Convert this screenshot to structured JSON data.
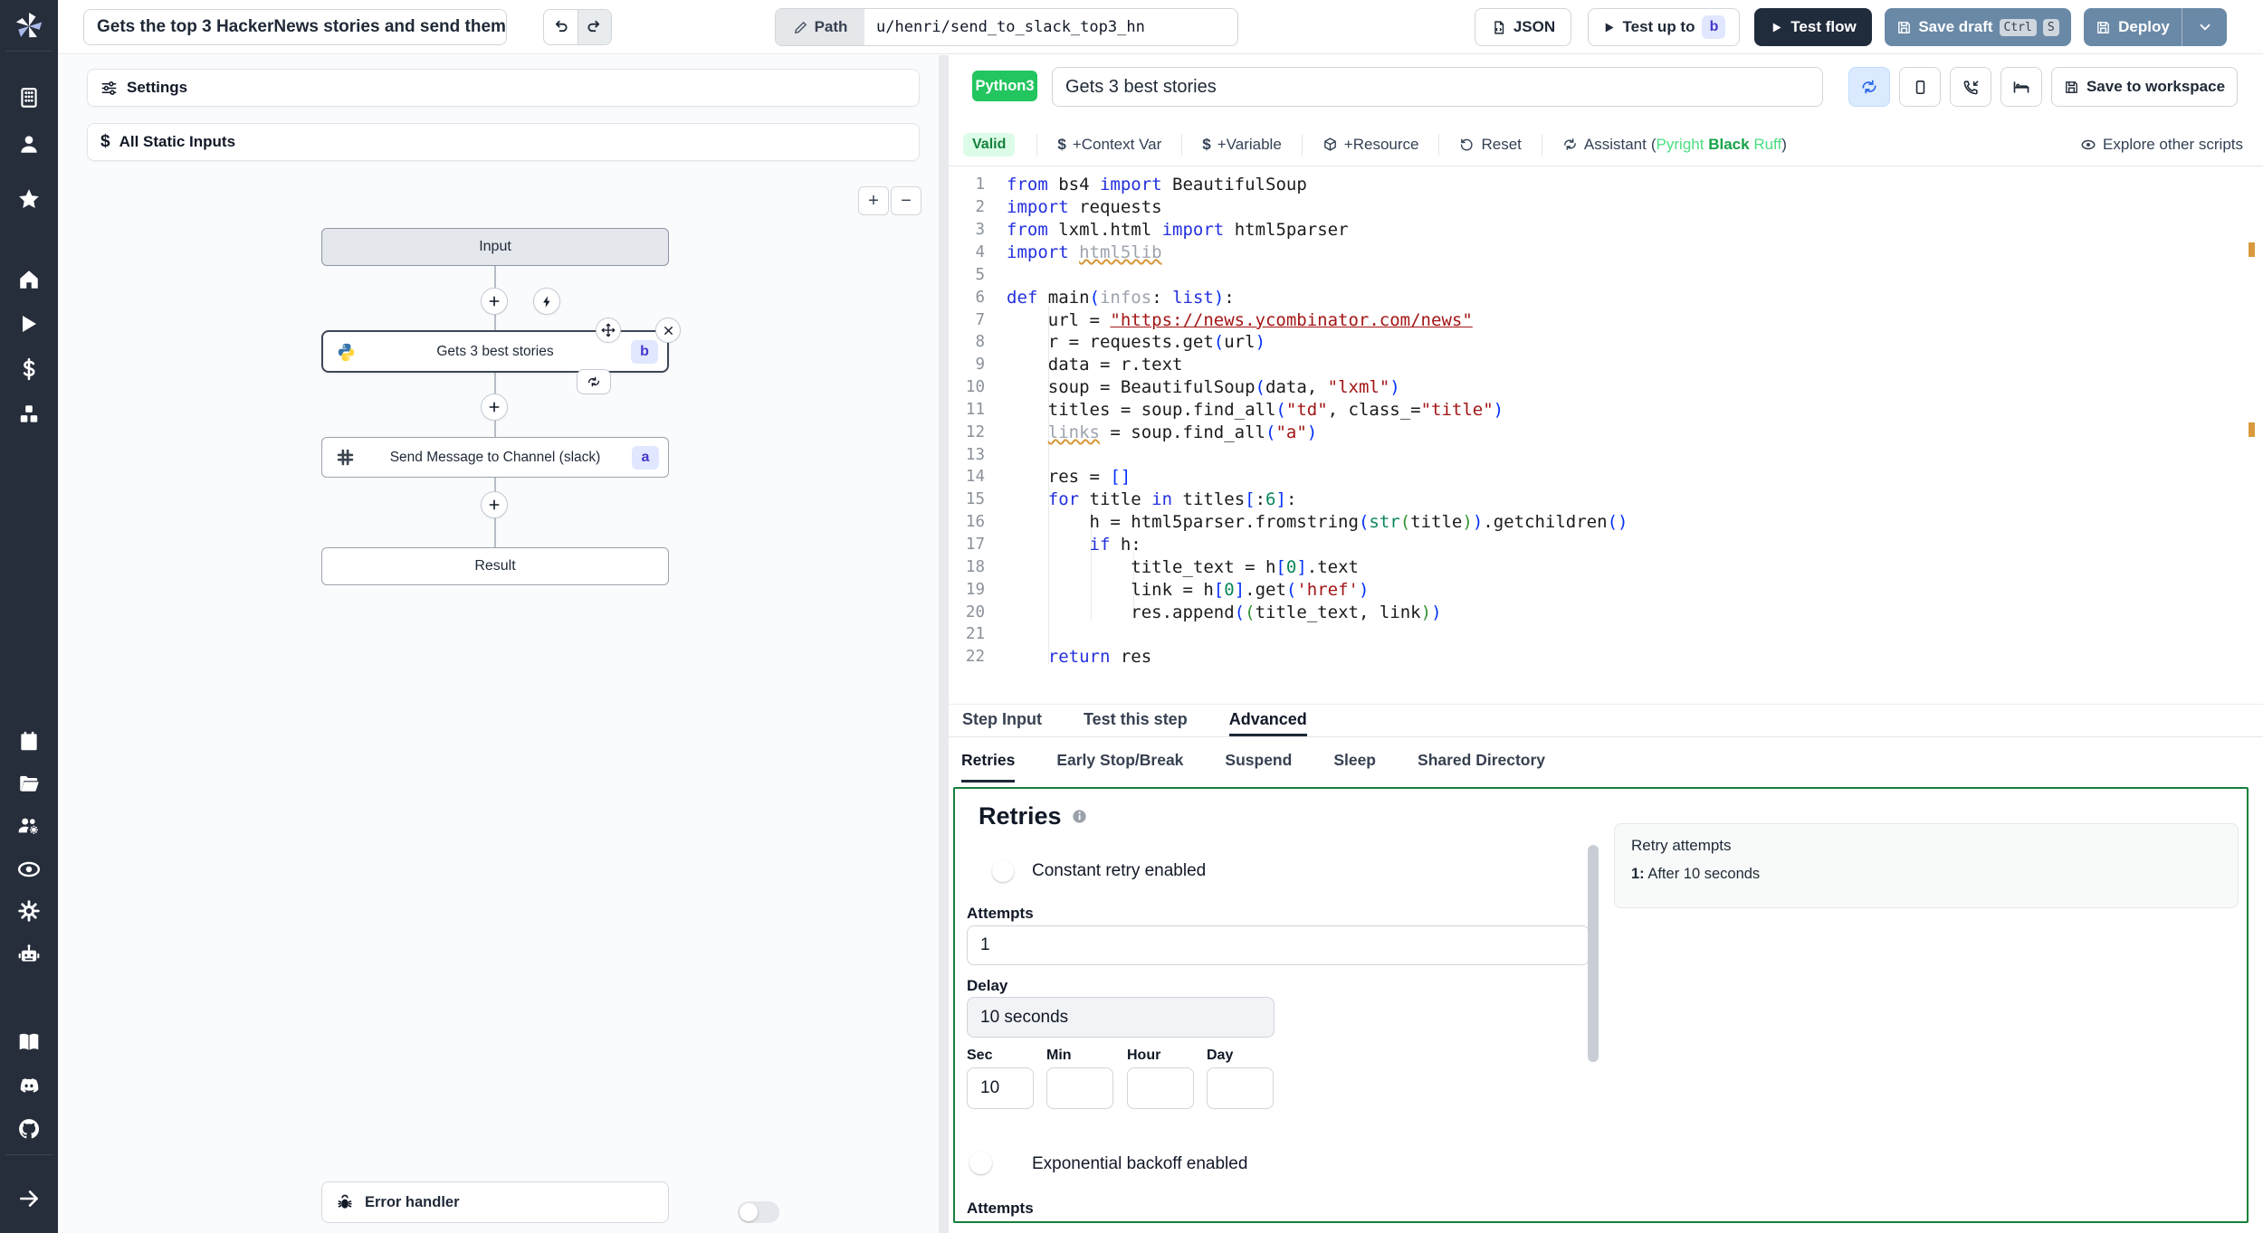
{
  "topbar": {
    "flow_title": "Gets the top 3 HackerNews stories and send them",
    "path_label": "Path",
    "path_value": "u/henri/send_to_slack_top3_hn",
    "json_label": "JSON",
    "test_up_to_label": "Test up to",
    "test_up_to_badge": "b",
    "test_flow_label": "Test flow",
    "save_draft_label": "Save draft",
    "kbd": [
      "Ctrl",
      "S"
    ],
    "deploy_label": "Deploy"
  },
  "sidebar": {
    "icons_top": [
      "building-icon",
      "user-icon",
      "star-icon"
    ],
    "icons_mid": [
      "home-icon",
      "play-icon",
      "dollar-icon",
      "boxes-icon"
    ],
    "icons_lower": [
      "calendar-icon",
      "folder-open-icon",
      "users-gear-icon",
      "eye-icon",
      "gear-icon",
      "robot-icon"
    ],
    "icons_docs": [
      "book-icon",
      "discord-icon",
      "github-icon"
    ],
    "icon_bottom": "arrow-right-icon"
  },
  "left_panel": {
    "settings_label": "Settings",
    "static_inputs_label": "All Static Inputs",
    "nodes": {
      "input": "Input",
      "step_b_label": "Gets 3 best stories",
      "step_b_badge": "b",
      "step_a_label": "Send Message to Channel (slack)",
      "step_a_badge": "a",
      "result": "Result",
      "error_handler": "Error handler"
    }
  },
  "editor": {
    "lang_badge": "Python3",
    "step_title": "Gets 3 best stories",
    "save_workspace_label": "Save to workspace",
    "toolbar": {
      "valid": "Valid",
      "context_var": "+Context Var",
      "variable": "+Variable",
      "resource": "+Resource",
      "reset": "Reset",
      "assistant": "Assistant",
      "assistant_paren_open": "(",
      "assistant_pyright": "Pyright",
      "assistant_black": "Black",
      "assistant_ruff": "Ruff",
      "assistant_paren_close": ")",
      "explore": "Explore other scripts"
    }
  },
  "code": {
    "lines": [
      [
        [
          "k",
          "from"
        ],
        [
          "p",
          " bs4 "
        ],
        [
          "k",
          "import"
        ],
        [
          "p",
          " BeautifulSoup"
        ]
      ],
      [
        [
          "k",
          "import"
        ],
        [
          "p",
          " requests"
        ]
      ],
      [
        [
          "k",
          "from"
        ],
        [
          "p",
          " lxml.html "
        ],
        [
          "k",
          "import"
        ],
        [
          "p",
          " html5parser"
        ]
      ],
      [
        [
          "k",
          "import"
        ],
        [
          "p",
          " "
        ],
        [
          "u",
          "html5lib"
        ]
      ],
      [],
      [
        [
          "k",
          "def"
        ],
        [
          "p",
          " main"
        ],
        [
          "g",
          "("
        ],
        [
          "v",
          "infos"
        ],
        [
          "p",
          ": "
        ],
        [
          "k",
          "list"
        ],
        [
          "g",
          ")"
        ],
        [
          "p",
          ":"
        ]
      ],
      [
        [
          "p",
          "    url = "
        ],
        [
          "sl",
          "\"https://news.ycombinator.com/news\""
        ]
      ],
      [
        [
          "p",
          "    r = requests.get"
        ],
        [
          "g",
          "("
        ],
        [
          "p",
          "url"
        ],
        [
          "g",
          ")"
        ]
      ],
      [
        [
          "p",
          "    data = r.text"
        ]
      ],
      [
        [
          "p",
          "    soup = BeautifulSoup"
        ],
        [
          "g",
          "("
        ],
        [
          "p",
          "data, "
        ],
        [
          "s",
          "\"lxml\""
        ],
        [
          "g",
          ")"
        ]
      ],
      [
        [
          "p",
          "    titles = soup.find_all"
        ],
        [
          "g",
          "("
        ],
        [
          "s",
          "\"td\""
        ],
        [
          "p",
          ", class_="
        ],
        [
          "s",
          "\"title\""
        ],
        [
          "g",
          ")"
        ]
      ],
      [
        [
          "p",
          "    "
        ],
        [
          "u",
          "links"
        ],
        [
          "p",
          " = soup.find_all"
        ],
        [
          "g",
          "("
        ],
        [
          "s",
          "\"a\""
        ],
        [
          "g",
          ")"
        ]
      ],
      [],
      [
        [
          "p",
          "    res = "
        ],
        [
          "g",
          "[]"
        ]
      ],
      [
        [
          "p",
          "    "
        ],
        [
          "k",
          "for"
        ],
        [
          "p",
          " title "
        ],
        [
          "k",
          "in"
        ],
        [
          "p",
          " titles"
        ],
        [
          "g",
          "["
        ],
        [
          "p",
          ":"
        ],
        [
          "n",
          "6"
        ],
        [
          "g",
          "]"
        ],
        [
          "p",
          ":"
        ]
      ],
      [
        [
          "p",
          "        h = html5parser.fromstring"
        ],
        [
          "g",
          "("
        ],
        [
          "b",
          "str"
        ],
        [
          "h",
          "("
        ],
        [
          "p",
          "title"
        ],
        [
          "h",
          ")"
        ],
        [
          "g",
          ")"
        ],
        [
          "p",
          ".getchildren"
        ],
        [
          "g",
          "()"
        ]
      ],
      [
        [
          "p",
          "        "
        ],
        [
          "k",
          "if"
        ],
        [
          "p",
          " h:"
        ]
      ],
      [
        [
          "p",
          "            title_text = h"
        ],
        [
          "g",
          "["
        ],
        [
          "n",
          "0"
        ],
        [
          "g",
          "]"
        ],
        [
          "p",
          ".text"
        ]
      ],
      [
        [
          "p",
          "            link = h"
        ],
        [
          "g",
          "["
        ],
        [
          "n",
          "0"
        ],
        [
          "g",
          "]"
        ],
        [
          "p",
          ".get"
        ],
        [
          "g",
          "("
        ],
        [
          "s",
          "'href'"
        ],
        [
          "g",
          ")"
        ]
      ],
      [
        [
          "p",
          "            res.append"
        ],
        [
          "g",
          "("
        ],
        [
          "h",
          "("
        ],
        [
          "p",
          "title_text, link"
        ],
        [
          "h",
          ")"
        ],
        [
          "g",
          ")"
        ]
      ],
      [],
      [
        [
          "p",
          "    "
        ],
        [
          "k",
          "return"
        ],
        [
          "p",
          " res"
        ]
      ]
    ]
  },
  "tabs": {
    "main": [
      "Step Input",
      "Test this step",
      "Advanced"
    ],
    "main_active": 2,
    "sub": [
      "Retries",
      "Early Stop/Break",
      "Suspend",
      "Sleep",
      "Shared Directory"
    ],
    "sub_active": 0
  },
  "retries": {
    "title": "Retries",
    "constant_label": "Constant retry enabled",
    "constant_enabled": true,
    "attempts_label": "Attempts",
    "attempts_value": "1",
    "delay_label": "Delay",
    "delay_value": "10 seconds",
    "units": [
      {
        "label": "Sec",
        "value": "10"
      },
      {
        "label": "Min",
        "value": ""
      },
      {
        "label": "Hour",
        "value": ""
      },
      {
        "label": "Day",
        "value": ""
      }
    ],
    "exponential_label": "Exponential backoff enabled",
    "exponential_enabled": false,
    "attempts2_label": "Attempts",
    "summary": {
      "title": "Retry attempts",
      "item_prefix": "1:",
      "item_text": " After 10 seconds"
    }
  },
  "colors": {
    "brand_button": "#6a89a7",
    "dark_button": "#202b3c",
    "lang_badge": "#22c55e",
    "valid_bg": "#dcfce7",
    "valid_text": "#15803d",
    "toggle_on": "#2563eb",
    "retries_border": "#15803d",
    "badge_bg": "#e0e7ff",
    "badge_text": "#4338ca",
    "warning_marker": "#d89a3d"
  }
}
